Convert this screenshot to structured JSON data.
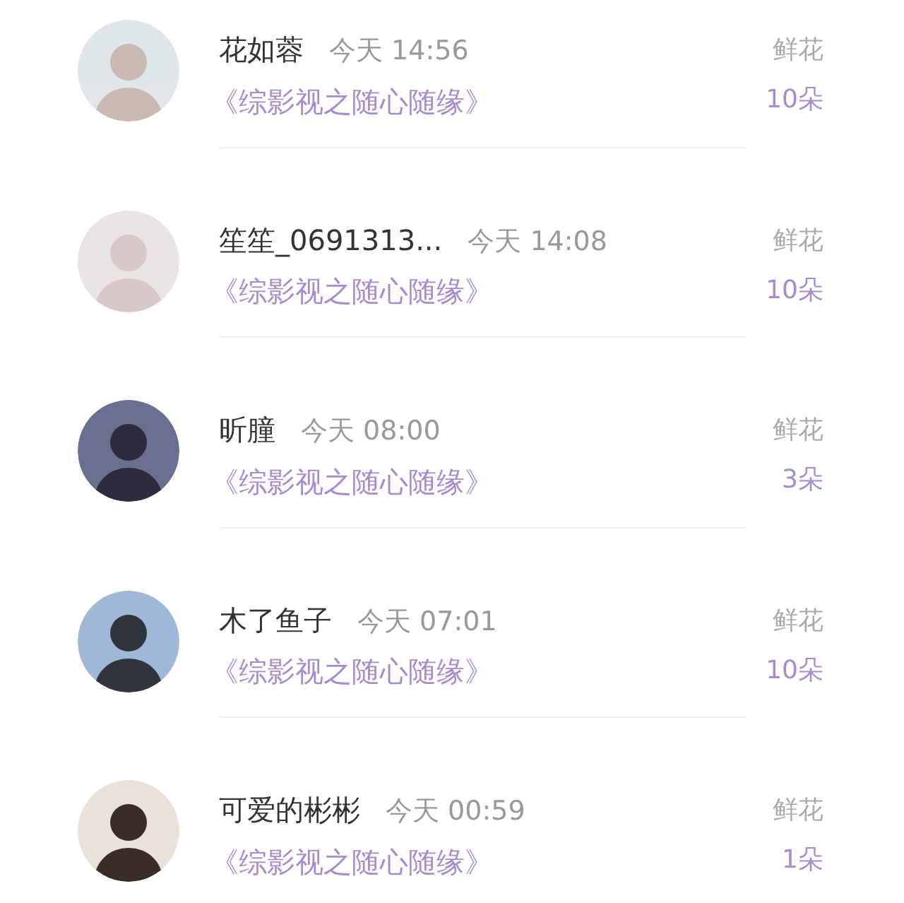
{
  "rows": [
    {
      "name": "花如蓉",
      "time": "今天 14:56",
      "book": "《综影视之随心随缘》",
      "label": "鲜花",
      "count": "10朵"
    },
    {
      "name": "笙笙_0691313...",
      "time": "今天 14:08",
      "book": "《综影视之随心随缘》",
      "label": "鲜花",
      "count": "10朵"
    },
    {
      "name": "昕朣",
      "time": "今天 08:00",
      "book": "《综影视之随心随缘》",
      "label": "鲜花",
      "count": "3朵"
    },
    {
      "name": "木了鱼子",
      "time": "今天 07:01",
      "book": "《综影视之随心随缘》",
      "label": "鲜花",
      "count": "10朵"
    },
    {
      "name": "可爱的彬彬",
      "time": "今天 00:59",
      "book": "《综影视之随心随缘》",
      "label": "鲜花",
      "count": "1朵"
    }
  ]
}
